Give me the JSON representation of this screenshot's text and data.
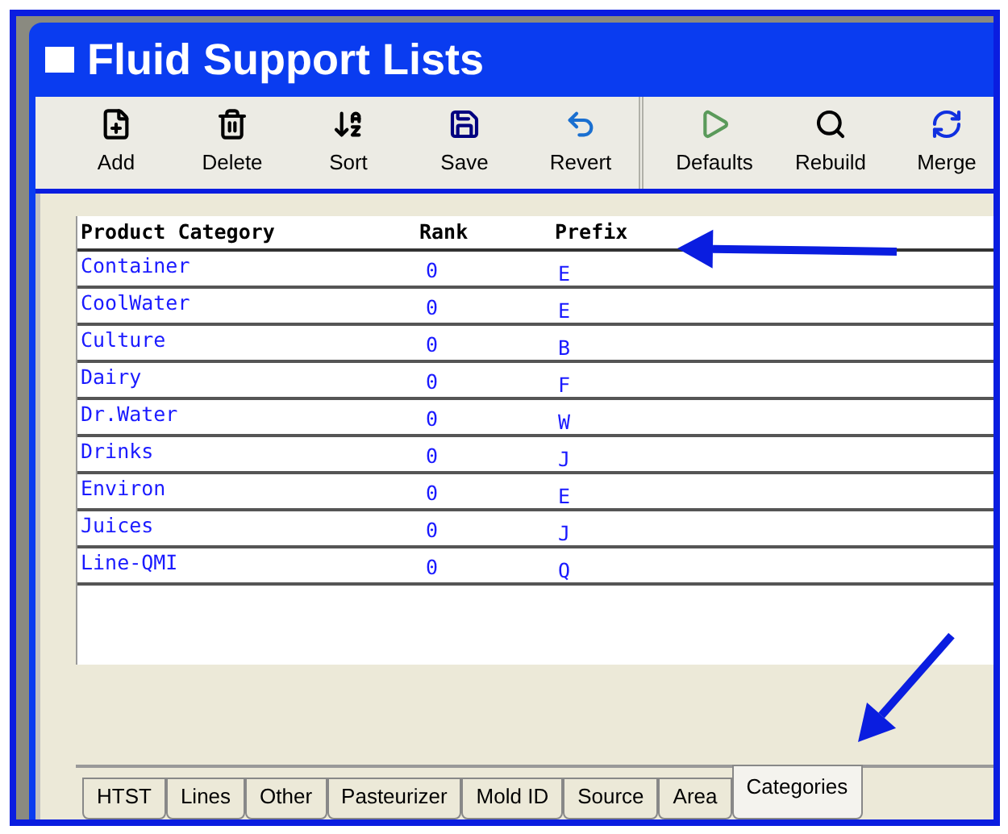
{
  "window": {
    "title": "Fluid Support Lists"
  },
  "toolbar": {
    "groups": [
      [
        "Add",
        "Delete",
        "Sort",
        "Save",
        "Revert"
      ],
      [
        "Defaults",
        "Rebuild",
        "Merge"
      ]
    ]
  },
  "table": {
    "columns": [
      "Product Category",
      "Rank",
      "Prefix"
    ],
    "rows": [
      {
        "category": "Container",
        "rank": "0",
        "prefix": "E"
      },
      {
        "category": "CoolWater",
        "rank": "0",
        "prefix": "E"
      },
      {
        "category": "Culture",
        "rank": "0",
        "prefix": "B"
      },
      {
        "category": "Dairy",
        "rank": "0",
        "prefix": "F"
      },
      {
        "category": "Dr.Water",
        "rank": "0",
        "prefix": "W"
      },
      {
        "category": "Drinks",
        "rank": "0",
        "prefix": "J"
      },
      {
        "category": "Environ",
        "rank": "0",
        "prefix": "E"
      },
      {
        "category": "Juices",
        "rank": "0",
        "prefix": "J"
      },
      {
        "category": "Line-QMI",
        "rank": "0",
        "prefix": "Q"
      }
    ]
  },
  "tabs": [
    {
      "label": "HTST",
      "selected": false
    },
    {
      "label": "Lines",
      "selected": false
    },
    {
      "label": "Other",
      "selected": false
    },
    {
      "label": "Pasteurizer",
      "selected": false
    },
    {
      "label": "Mold ID",
      "selected": false
    },
    {
      "label": "Source",
      "selected": false
    },
    {
      "label": "Area",
      "selected": false
    },
    {
      "label": "Categories",
      "selected": true
    }
  ]
}
